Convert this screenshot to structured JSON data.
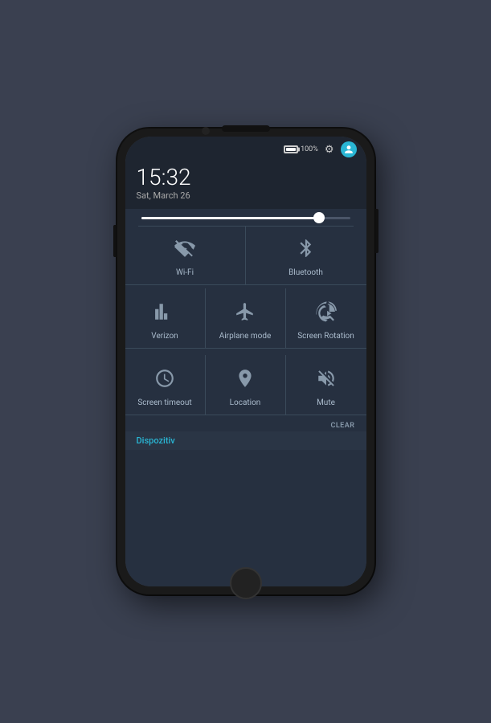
{
  "phone": {
    "status_bar": {
      "battery_percent": "100%",
      "settings_icon": "⚙",
      "user_icon": "👤"
    },
    "time": "15:32",
    "date": "Sat, March 26",
    "quick_settings": {
      "brightness_value": 85,
      "toggles_row1": [
        {
          "id": "wifi",
          "label": "Wi-Fi",
          "active": false,
          "icon": "wifi-off"
        },
        {
          "id": "bluetooth",
          "label": "Bluetooth",
          "active": false,
          "icon": "bluetooth"
        }
      ],
      "toggles_row2": [
        {
          "id": "verizon",
          "label": "Verizon",
          "active": true,
          "icon": "signal"
        },
        {
          "id": "airplane",
          "label": "Airplane mode",
          "active": false,
          "icon": "airplane"
        },
        {
          "id": "rotation",
          "label": "Screen Rotation",
          "active": false,
          "icon": "rotation"
        }
      ],
      "toggles_row3": [
        {
          "id": "screen-timeout",
          "label": "Screen timeout",
          "active": false,
          "icon": "clock"
        },
        {
          "id": "location",
          "label": "Location",
          "active": false,
          "icon": "location"
        },
        {
          "id": "mute",
          "label": "Mute",
          "active": false,
          "icon": "mute"
        }
      ]
    },
    "bottom_bar": {
      "dispozitiv_label": "Dispozitiv",
      "clear_label": "CLEAR"
    }
  }
}
